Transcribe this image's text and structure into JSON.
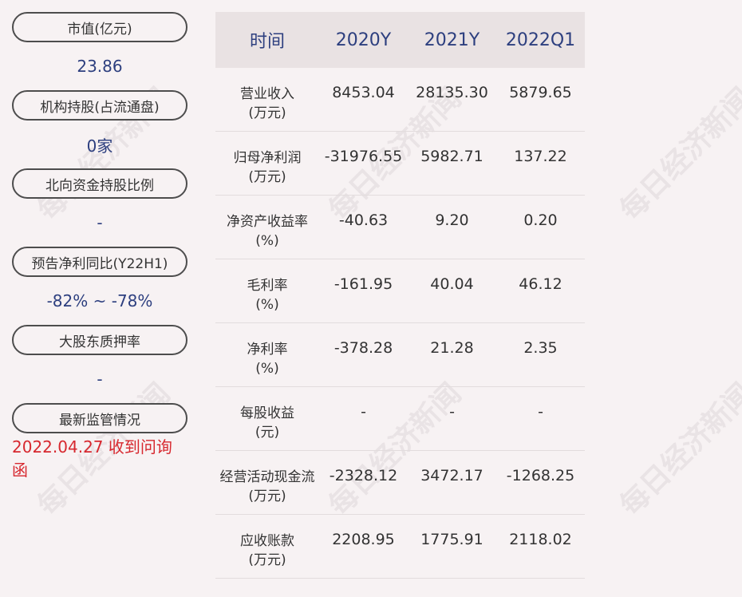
{
  "left_panel": [
    {
      "label": "市值(亿元)",
      "value": "23.86"
    },
    {
      "label": "机构持股(占流通盘)",
      "value": "0家"
    },
    {
      "label": "北向资金持股比例",
      "value": "-"
    },
    {
      "label": "预告净利同比(Y22H1)",
      "value": "-82% ~ -78%"
    },
    {
      "label": "大股东质押率",
      "value": "-"
    },
    {
      "label": "最新监管情况",
      "value": "2022.04.27 收到问询函"
    }
  ],
  "table": {
    "headers": [
      "时间",
      "2020Y",
      "2021Y",
      "2022Q1"
    ],
    "rows": [
      {
        "name": "营业收入",
        "unit": "(万元)",
        "values": [
          "8453.04",
          "28135.30",
          "5879.65"
        ]
      },
      {
        "name": "归母净利润",
        "unit": "(万元)",
        "values": [
          "-31976.55",
          "5982.71",
          "137.22"
        ]
      },
      {
        "name": "净资产收益率",
        "unit": "(%)",
        "values": [
          "-40.63",
          "9.20",
          "0.20"
        ]
      },
      {
        "name": "毛利率",
        "unit": "(%)",
        "values": [
          "-161.95",
          "40.04",
          "46.12"
        ]
      },
      {
        "name": "净利率",
        "unit": "(%)",
        "values": [
          "-378.28",
          "21.28",
          "2.35"
        ]
      },
      {
        "name": "每股收益",
        "unit": "(元)",
        "values": [
          "-",
          "-",
          "-"
        ]
      },
      {
        "name": "经营活动现金流",
        "unit": "(万元)",
        "values": [
          "-2328.12",
          "3472.17",
          "-1268.25"
        ]
      },
      {
        "name": "应收账款",
        "unit": "(万元)",
        "values": [
          "2208.95",
          "1775.91",
          "2118.02"
        ]
      }
    ]
  },
  "watermark": "每日经济新闻",
  "colors": {
    "value_blue": "#2d3f7f",
    "alert_red": "#d7282f",
    "header_bg": "#e9e2e3",
    "page_bg": "#f7f2f3"
  }
}
